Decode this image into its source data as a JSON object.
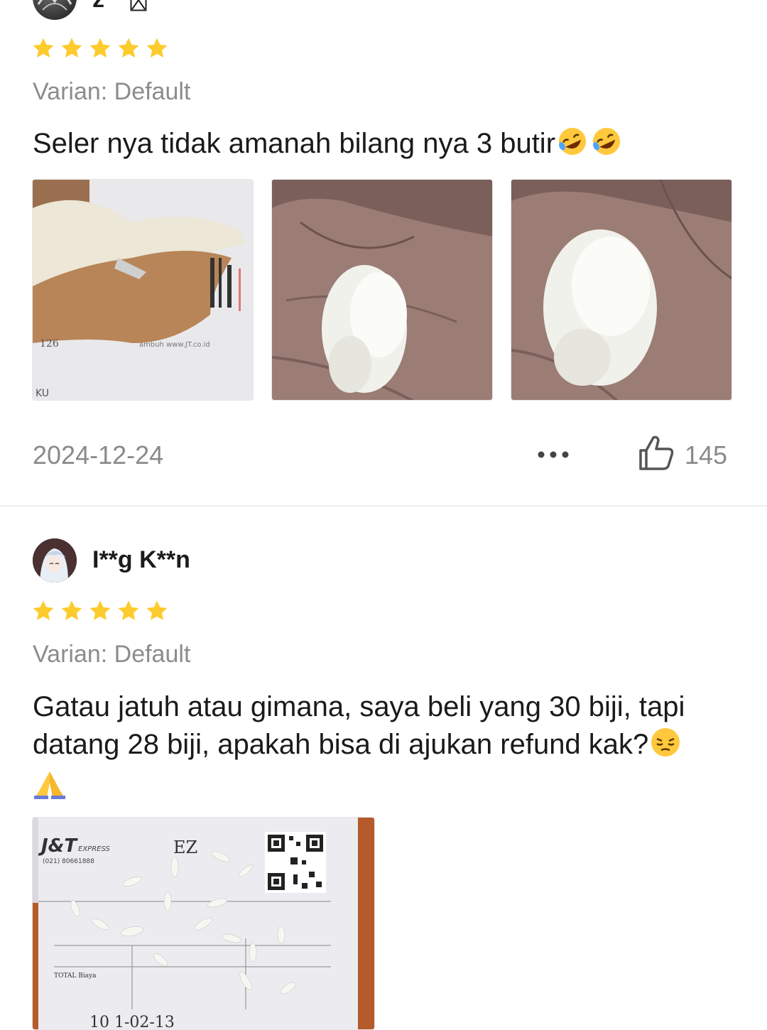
{
  "review1": {
    "username": "z",
    "rating": 5,
    "variant": "Varian: Default",
    "text": "Seler nya tidak amanah bilang nya 3 butir",
    "text_emojis": [
      "rolling-on-floor-laughing-emoji",
      "rolling-on-floor-laughing-emoji"
    ],
    "photos": [
      "photo-package-torn",
      "photo-rice-in-hand",
      "photo-rice-in-hand-2"
    ],
    "date": "2024-12-24",
    "likes": "145"
  },
  "review2": {
    "username": "I**g K**n",
    "rating": 5,
    "variant": "Varian: Default",
    "text_line1": "Gatau jatuh atau gimana, saya beli yang 30 biji, tapi",
    "text_line2": "datang 28 biji, apakah bisa di ajukan refund kak?",
    "text_emojis": [
      "pensive-face-emoji",
      "folded-hands-emoji"
    ],
    "photos": [
      "photo-jnt-shipping-label-with-rice"
    ],
    "label": {
      "brand": "J&T",
      "brand_suffix": "EXPRESS",
      "phone": "(021) 80661888",
      "code": "EZ",
      "total": "TOTAL Biaya",
      "number_fragment": "10 1-02-13"
    }
  },
  "colors": {
    "star": "#FDCB2D",
    "muted_text": "#8C8C8C",
    "divider": "#EEEEEE"
  }
}
